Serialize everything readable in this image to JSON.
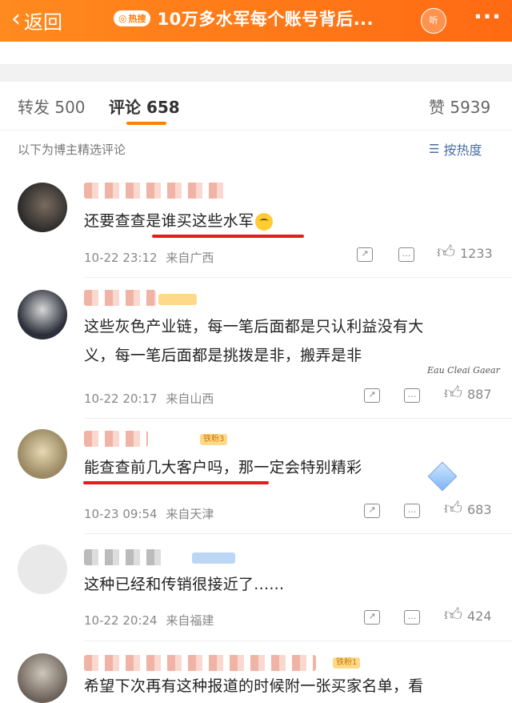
{
  "header": {
    "back_label": "返回",
    "hot_label": "热搜",
    "title": "10万多水军每个账号背后...",
    "listen_label": "听",
    "more_label": "···"
  },
  "tabs": {
    "repost": "转发 500",
    "comment": "评论 658",
    "like": "赞 5939"
  },
  "list": {
    "curated_label": "以下为博主精选评论",
    "sort_label": "按热度"
  },
  "comments": [
    {
      "text": "还要查查是谁买这些水军",
      "time": "10-22 23:12",
      "location": "来自广西",
      "likes": "1233"
    },
    {
      "text1": "这些灰色产业链，每一笔后面都是只认利益没有大",
      "text2": "义，每一笔后面都是挑拨是非，搬弄是非",
      "time": "10-22 20:17",
      "location": "来自山西",
      "likes": "887",
      "badge": "",
      "sticker": "Eau Cleai Gaear"
    },
    {
      "text": "能查查前几大客户吗，那一定会特别精彩",
      "time": "10-23 09:54",
      "location": "来自天津",
      "likes": "683",
      "badge": "铁粉3"
    },
    {
      "text": "这种已经和传销很接近了......",
      "time": "10-22 20:24",
      "location": "来自福建",
      "likes": "424"
    },
    {
      "text": "希望下次再有这种报道的时候附一张买家名单，看",
      "badge": "铁粉1"
    }
  ],
  "colors": {
    "header_orange": "#ff7a18",
    "accent_orange": "#ff8200",
    "highlight_red": "#e41c1c",
    "link_blue": "#4a6fa5"
  }
}
